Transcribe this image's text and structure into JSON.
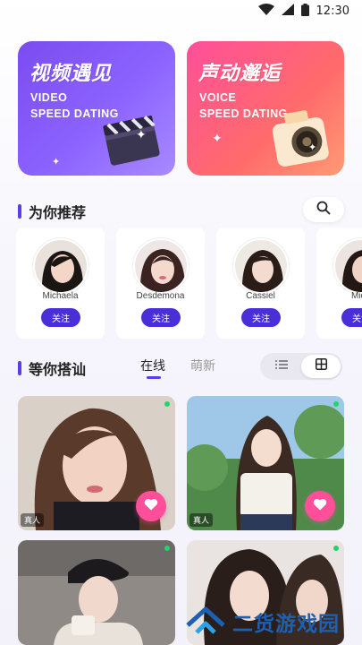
{
  "status_bar": {
    "time": "12:30"
  },
  "features": [
    {
      "title": "视频遇见",
      "line1": "VIDEO",
      "line2": "SPEED DATING"
    },
    {
      "title": "声动邂逅",
      "line1": "VOICE",
      "line2": "SPEED DATING"
    }
  ],
  "recommend": {
    "title": "为你推荐",
    "users": [
      {
        "name": "Michaela",
        "follow_label": "关注"
      },
      {
        "name": "Desdemona",
        "follow_label": "关注"
      },
      {
        "name": "Cassiel",
        "follow_label": "关注"
      },
      {
        "name": "Mich",
        "follow_label": "关注"
      }
    ]
  },
  "chat": {
    "title": "等你搭讪",
    "tabs": [
      {
        "label": "在线"
      },
      {
        "label": "萌新"
      }
    ],
    "cards": [
      {
        "badge": "真人"
      },
      {
        "badge": "真人"
      },
      {
        "badge": ""
      },
      {
        "badge": ""
      }
    ]
  },
  "watermark": {
    "text": "二货游戏园"
  },
  "colors": {
    "accent": "#4a2fd8",
    "pink": "#ff4f9a",
    "online": "#26d36b"
  }
}
